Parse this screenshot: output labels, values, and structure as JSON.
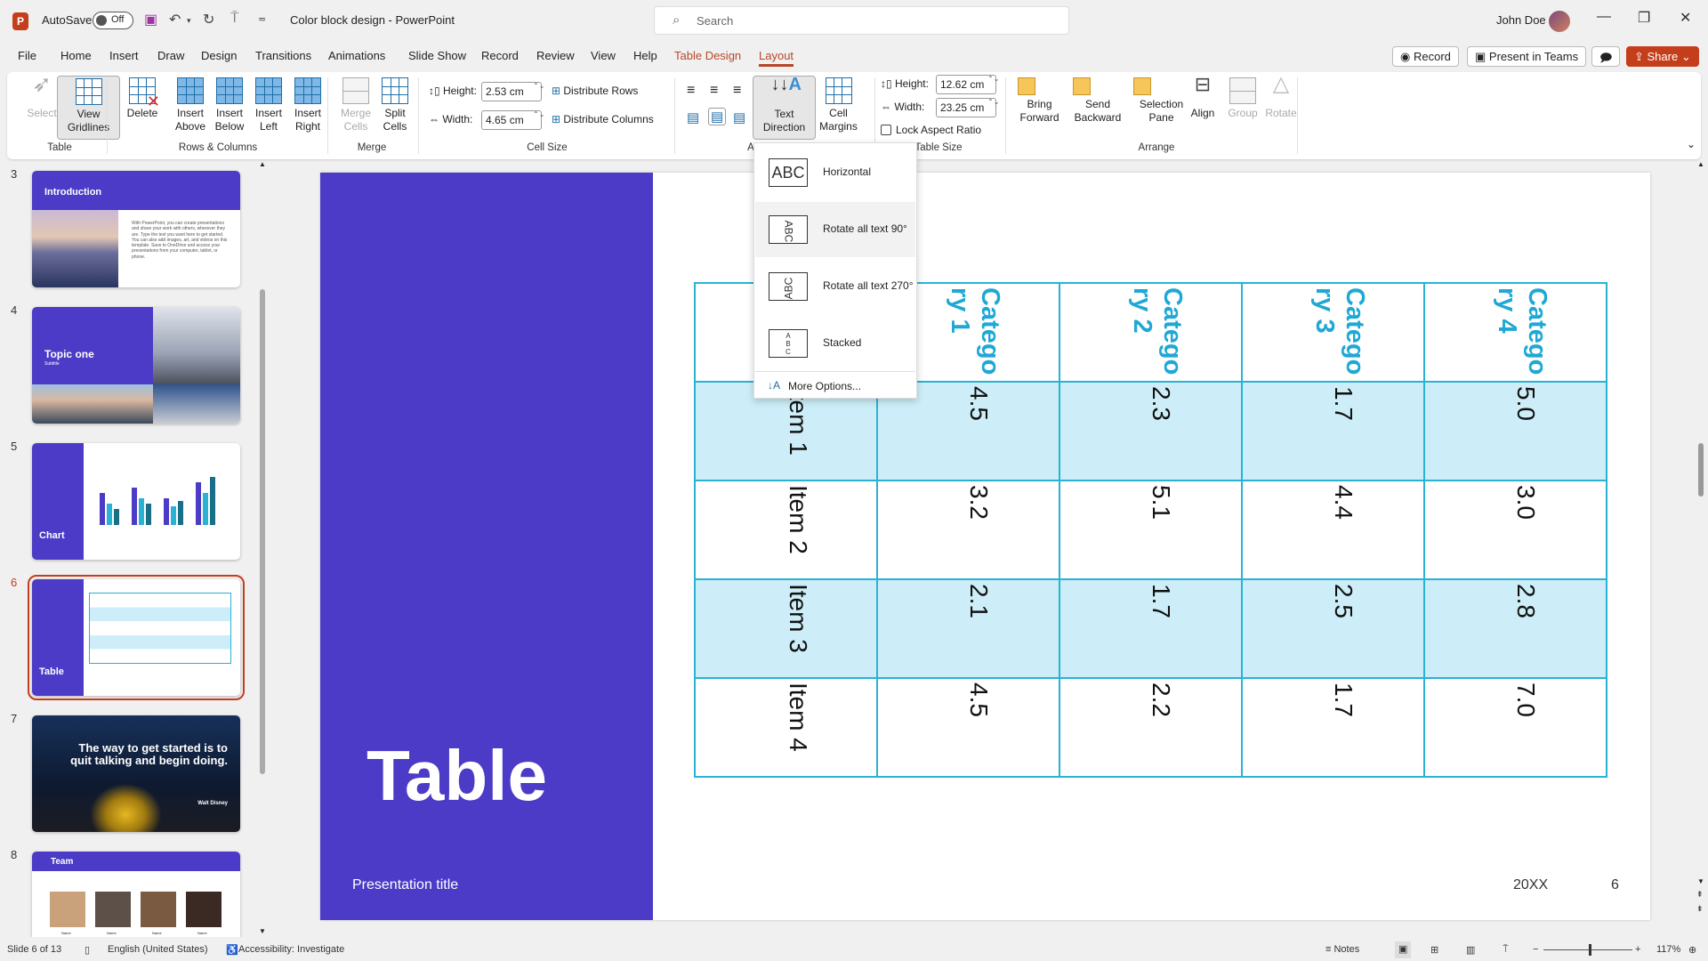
{
  "titlebar": {
    "autosave_label": "AutoSave",
    "autosave_state": "Off",
    "document_title": "Color block design  -  PowerPoint",
    "search_placeholder": "Search",
    "user_name": "John Doe"
  },
  "tabs": [
    "File",
    "Home",
    "Insert",
    "Draw",
    "Design",
    "Transitions",
    "Animations",
    "Slide Show",
    "Record",
    "Review",
    "View",
    "Help",
    "Table Design",
    "Layout"
  ],
  "active_tab": "Layout",
  "top_buttons": {
    "record": "Record",
    "present_teams": "Present in Teams",
    "share": "Share"
  },
  "ribbon": {
    "table": {
      "label": "Table",
      "select": "Select",
      "view_gridlines": "View\nGridlines"
    },
    "rows_columns": {
      "label": "Rows & Columns",
      "delete": "Delete",
      "insert_above": "Insert\nAbove",
      "insert_below": "Insert\nBelow",
      "insert_left": "Insert\nLeft",
      "insert_right": "Insert\nRight"
    },
    "merge": {
      "label": "Merge",
      "merge_cells": "Merge\nCells",
      "split_cells": "Split\nCells"
    },
    "cell_size": {
      "label": "Cell Size",
      "height_label": "Height:",
      "height_value": "2.53 cm",
      "width_label": "Width:",
      "width_value": "4.65 cm",
      "distribute_rows": "Distribute Rows",
      "distribute_columns": "Distribute Columns"
    },
    "alignment": {
      "label": "A",
      "text_direction": "Text\nDirection",
      "cell_margins": "Cell\nMargins"
    },
    "table_size": {
      "label": "Table Size",
      "height_label": "Height:",
      "height_value": "12.62 cm",
      "width_label": "Width:",
      "width_value": "23.25 cm",
      "lock_aspect": "Lock Aspect Ratio",
      "lock_checked": false
    },
    "arrange": {
      "label": "Arrange",
      "bring_forward": "Bring\nForward",
      "send_backward": "Send\nBackward",
      "selection_pane": "Selection\nPane",
      "align": "Align",
      "group": "Group",
      "rotate": "Rotate"
    }
  },
  "text_direction_menu": {
    "items": [
      "Horizontal",
      "Rotate all text 90°",
      "Rotate all text 270°",
      "Stacked"
    ],
    "highlighted": "Rotate all text 90°",
    "more": "More Options..."
  },
  "thumbnails": [
    {
      "num": "3",
      "title": "Introduction",
      "body": "With PowerPoint, you can create presentations and share your work with others, wherever they are. Type the text you want here to get started. You can also add images, art, and videos on this template. Save to OneDrive and access your presentations from your computer, tablet, or phone."
    },
    {
      "num": "4",
      "title": "Topic one",
      "subtitle": "Subtitle"
    },
    {
      "num": "5",
      "title": "Chart"
    },
    {
      "num": "6",
      "title": "Table",
      "selected": true
    },
    {
      "num": "7",
      "quote": "The way to get started is to quit  talking and begin doing.",
      "author": "Walt Disney"
    },
    {
      "num": "8",
      "title": "Team",
      "names": [
        "Name",
        "Name",
        "Name",
        "Name"
      ]
    }
  ],
  "slide": {
    "title": "Table",
    "presentation_title": "Presentation title",
    "date": "20XX",
    "page": "6",
    "table": {
      "headers": [
        "",
        "Category 1",
        "Category 2",
        "Category 3",
        "Category 4"
      ],
      "rows": [
        [
          "Item 1",
          "4.5",
          "2.3",
          "1.7",
          "5.0"
        ],
        [
          "Item 2",
          "3.2",
          "5.1",
          "4.4",
          "3.0"
        ],
        [
          "Item 3",
          "2.1",
          "1.7",
          "2.5",
          "2.8"
        ],
        [
          "Item 4",
          "4.5",
          "2.2",
          "1.7",
          "7.0"
        ]
      ]
    }
  },
  "status": {
    "slide_count": "Slide 6 of 13",
    "language": "English (United States)",
    "accessibility": "Accessibility: Investigate",
    "notes": "Notes",
    "zoom": "117%"
  },
  "colors": {
    "accent_purple": "#4b3bc6",
    "table_border": "#29b2d4",
    "table_header_text": "#1fa8d4",
    "row_shade": "#cdeef8",
    "office_accent": "#c43e1c"
  }
}
